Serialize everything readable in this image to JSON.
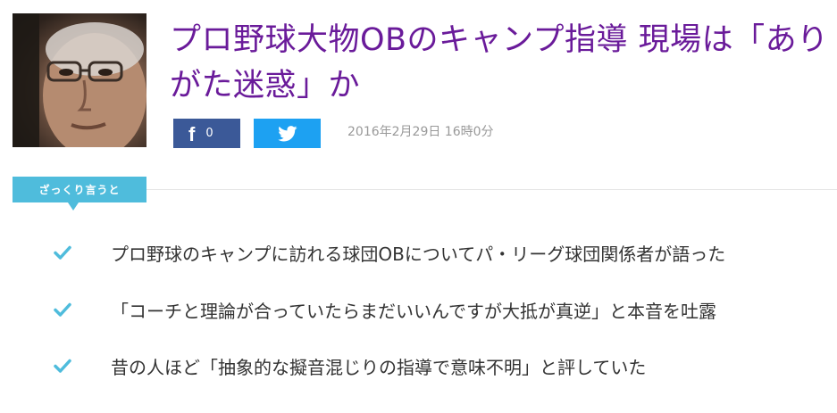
{
  "article": {
    "title": "プロ野球大物OBのキャンプ指導 現場は「ありがた迷惑」か",
    "date": "2016年2月29日 16時0分"
  },
  "share": {
    "facebook_glyph": "f",
    "facebook_count": "0",
    "facebook_color": "#3b5998",
    "twitter_color": "#1da1f2"
  },
  "summary": {
    "label": "ざっくり言うと",
    "accent_color": "#4fbcdc",
    "points": [
      "プロ野球のキャンプに訪れる球団OBについてパ・リーグ球団関係者が語った",
      "「コーチと理論が合っていたらまだいいんですが大抵が真逆」と本音を吐露",
      "昔の人ほど「抽象的な擬音混じりの指導で意味不明」と評していた"
    ]
  },
  "icons": {
    "thumbnail": "portrait-photo",
    "facebook": "facebook-icon",
    "twitter": "twitter-bird-icon",
    "bullet": "check-icon"
  }
}
